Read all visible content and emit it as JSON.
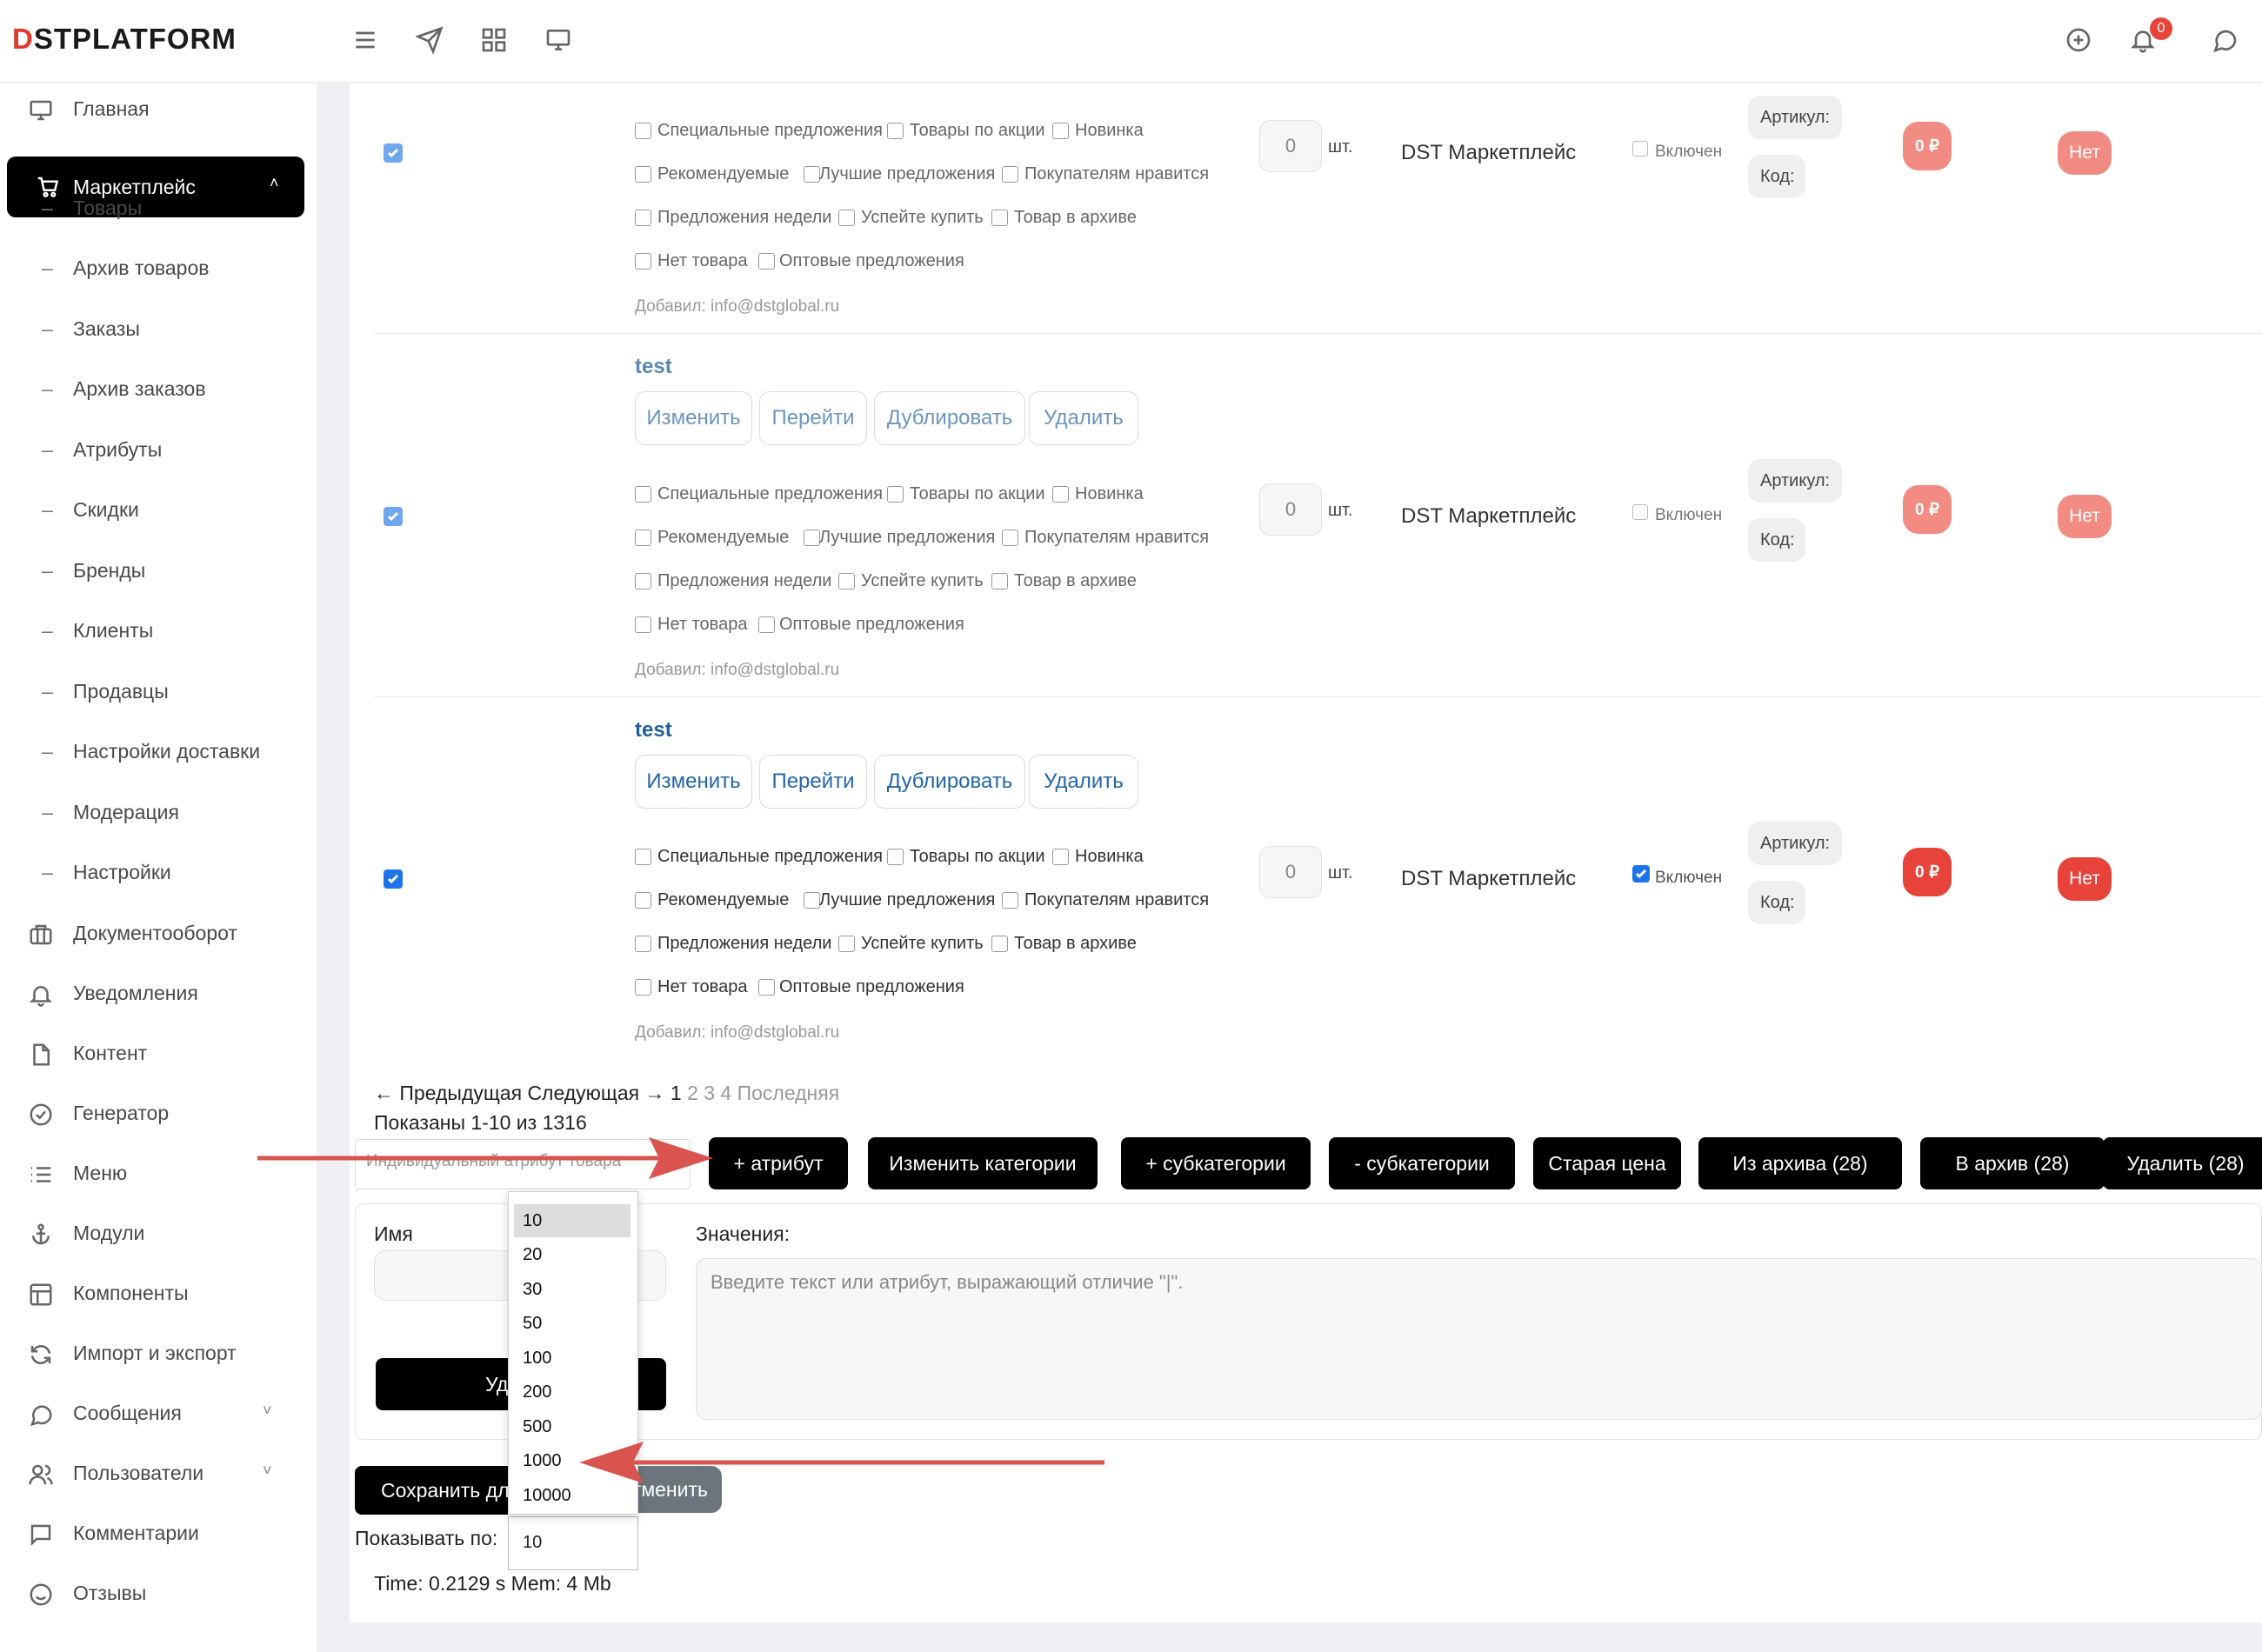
{
  "brand": {
    "logo_d": "D",
    "logo_rest": "STPLATFORM"
  },
  "topbar": {
    "notification_count": "0"
  },
  "sidebar": {
    "items": [
      {
        "label": "Главная",
        "icon": "monitor-icon"
      },
      {
        "label": "Маркетплейс",
        "icon": "cart-icon",
        "active": true,
        "chevron": "˄"
      },
      {
        "label": "Товары",
        "sub": true
      },
      {
        "label": "Архив товаров",
        "sub": true
      },
      {
        "label": "Заказы",
        "sub": true
      },
      {
        "label": "Архив заказов",
        "sub": true
      },
      {
        "label": "Атрибуты",
        "sub": true
      },
      {
        "label": "Скидки",
        "sub": true
      },
      {
        "label": "Бренды",
        "sub": true
      },
      {
        "label": "Клиенты",
        "sub": true
      },
      {
        "label": "Продавцы",
        "sub": true
      },
      {
        "label": "Настройки доставки",
        "sub": true
      },
      {
        "label": "Модерация",
        "sub": true
      },
      {
        "label": "Настройки",
        "sub": true
      },
      {
        "label": "Документооборот",
        "icon": "briefcase-icon"
      },
      {
        "label": "Уведомления",
        "icon": "bell-icon"
      },
      {
        "label": "Контент",
        "icon": "file-icon"
      },
      {
        "label": "Генератор",
        "icon": "check-circle-icon"
      },
      {
        "label": "Меню",
        "icon": "list-icon"
      },
      {
        "label": "Модули",
        "icon": "anchor-icon"
      },
      {
        "label": "Компоненты",
        "icon": "layout-icon"
      },
      {
        "label": "Импорт и экспорт",
        "icon": "refresh-icon"
      },
      {
        "label": "Сообщения",
        "icon": "chat-icon",
        "chevron": "˅"
      },
      {
        "label": "Пользователи",
        "icon": "users-icon",
        "chevron": "˅"
      },
      {
        "label": "Комментарии",
        "icon": "comment-icon"
      },
      {
        "label": "Отзывы",
        "icon": "smile-icon"
      }
    ]
  },
  "product_common": {
    "flags": [
      [
        "Специальные предложения",
        "Товары по акции",
        "Новинка"
      ],
      [
        "Рекомендуемые",
        "Лучшие предложения",
        "Покупателям нравится"
      ],
      [
        "Предложения недели",
        "Успейте купить",
        "Товар в архиве"
      ],
      [
        "Нет товара",
        "Оптовые предложения"
      ]
    ],
    "qty": "0",
    "unit": "шт.",
    "seller": "DST Маркетплейс",
    "enabled_label": "Включен",
    "article_label": "Артикул:",
    "code_label": "Код:",
    "price": "0 ₽",
    "stock_label": "Нет",
    "added_by": "Добавил: info@dstglobal.ru"
  },
  "products": [
    {
      "title": "",
      "enabled": false,
      "faded": true
    },
    {
      "title": "test",
      "enabled": false,
      "faded": true,
      "actions": [
        "Изменить",
        "Перейти",
        "Дублировать",
        "Удалить"
      ]
    },
    {
      "title": "test",
      "enabled": true,
      "faded": false,
      "actions": [
        "Изменить",
        "Перейти",
        "Дублировать",
        "Удалить"
      ]
    }
  ],
  "pagination": {
    "prev": "← Предыдущая",
    "next": "Следующая →",
    "current": "1",
    "pages": "2 3 4",
    "last": "Последняя",
    "shown": "Показаны 1-10 из 1316"
  },
  "bulk": {
    "attr_placeholder": "Индивидуальный атрибут товара",
    "buttons": [
      "+ атрибут",
      "Изменить категории",
      "+ субкатегории",
      "- субкатегории",
      "Старая цена",
      "Из архива (28)",
      "В архив (28)",
      "Удалить (28)"
    ]
  },
  "attr_form": {
    "name_label": "Имя",
    "values_label": "Значения:",
    "values_placeholder": "Введите текст или атрибут, выражающий отличие \"|\".",
    "delete_btn_visible": "Уда",
    "save_btn_visible": "Сохранить для",
    "cancel_btn_visible": "тменить"
  },
  "per_page": {
    "label": "Показывать по:",
    "value": "10",
    "options": [
      "10",
      "20",
      "30",
      "50",
      "100",
      "200",
      "500",
      "1000",
      "10000"
    ]
  },
  "footer": {
    "stats": "Time: 0.2129 s Mem: 4 Mb"
  },
  "colors": {
    "accent_red": "#e8433b",
    "annotation_arrow": "#d9534f",
    "link_blue": "#2266a8",
    "checkbox_blue": "#1d74e8"
  }
}
